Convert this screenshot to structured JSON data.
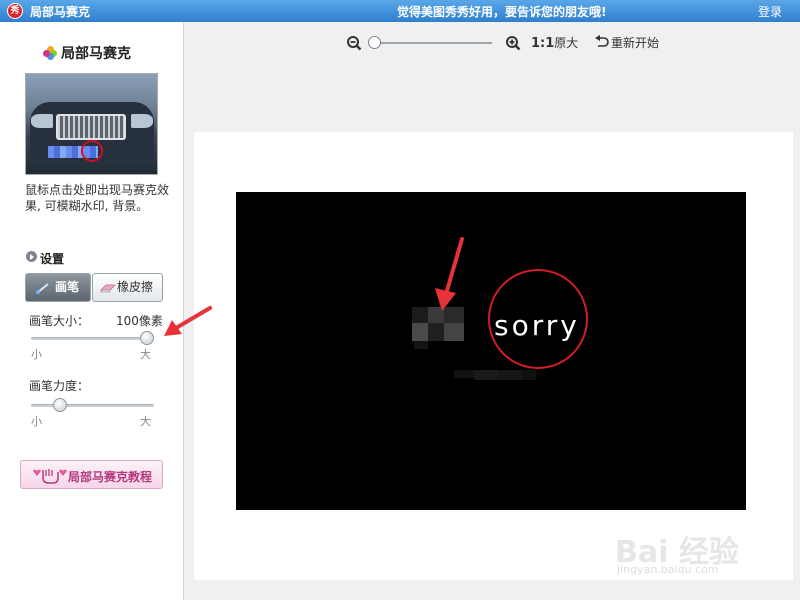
{
  "titlebar": {
    "app_logo": "秀",
    "app_title": "局部马赛克",
    "feedback": "觉得美图秀秀好用，要告诉您的朋友哦!",
    "login": "登录"
  },
  "panel": {
    "title": "局部马赛克",
    "description": "鼠标点击处即出现马赛克效果, 可模糊水印, 背景。",
    "settings_label": "设置",
    "tabs": [
      {
        "label": "画笔",
        "icon": "brush-icon",
        "active": true
      },
      {
        "label": "橡皮擦",
        "icon": "eraser-icon",
        "active": false
      }
    ],
    "brush_size": {
      "label": "画笔大小：",
      "value": "100像素",
      "min_label": "小",
      "max_label": "大",
      "level": 1.0
    },
    "brush_force": {
      "label": "画笔力度：",
      "min_label": "小",
      "max_label": "大",
      "level": 0.2
    },
    "tutorial_button": "局部马赛克教程"
  },
  "toolbar": {
    "zoom_level": 0,
    "actual_size_prefix": "1:1",
    "actual_size_label": "原大",
    "restart_label": "重新开始"
  },
  "canvas": {
    "sorry_text": "sorry"
  },
  "watermark": {
    "main": "Bai 经验",
    "sub": "jingyan.baidu.com"
  },
  "colors": {
    "titlebar": "#3a8ad6",
    "accent_red": "#d21c26",
    "annotation_red": "#e8323a",
    "tutorial_text": "#b23a7d"
  }
}
